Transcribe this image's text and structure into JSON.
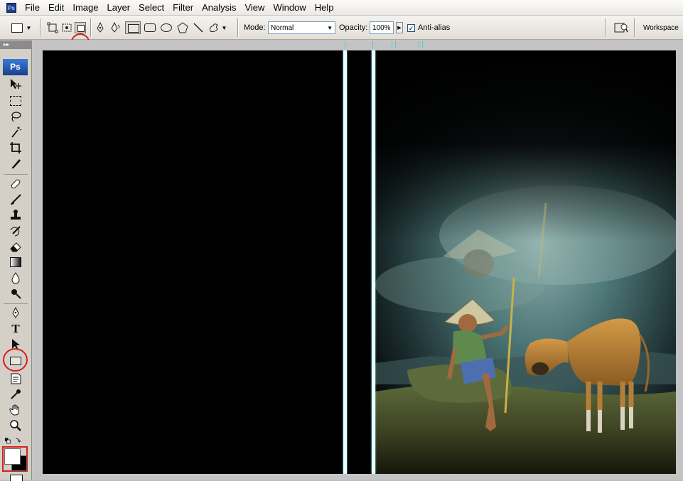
{
  "menubar": {
    "app_icon": "Ps",
    "items": [
      "File",
      "Edit",
      "Image",
      "Layer",
      "Select",
      "Filter",
      "Analysis",
      "View",
      "Window",
      "Help"
    ]
  },
  "options": {
    "mode_label": "Mode:",
    "mode_value": "Normal",
    "opacity_label": "Opacity:",
    "opacity_value": "100%",
    "antialias_label": "Anti-alias",
    "antialias_checked": true,
    "workspace_label": "Workspace",
    "highlighted_tool": "rectangle-tool"
  },
  "toolbox": {
    "logo": "Ps",
    "highlighted_tool": "rectangle-tool"
  },
  "colors": {
    "highlight": "#d62020",
    "guide": "#e8ffff",
    "foreground": "#ffffff",
    "background": "#000000"
  }
}
